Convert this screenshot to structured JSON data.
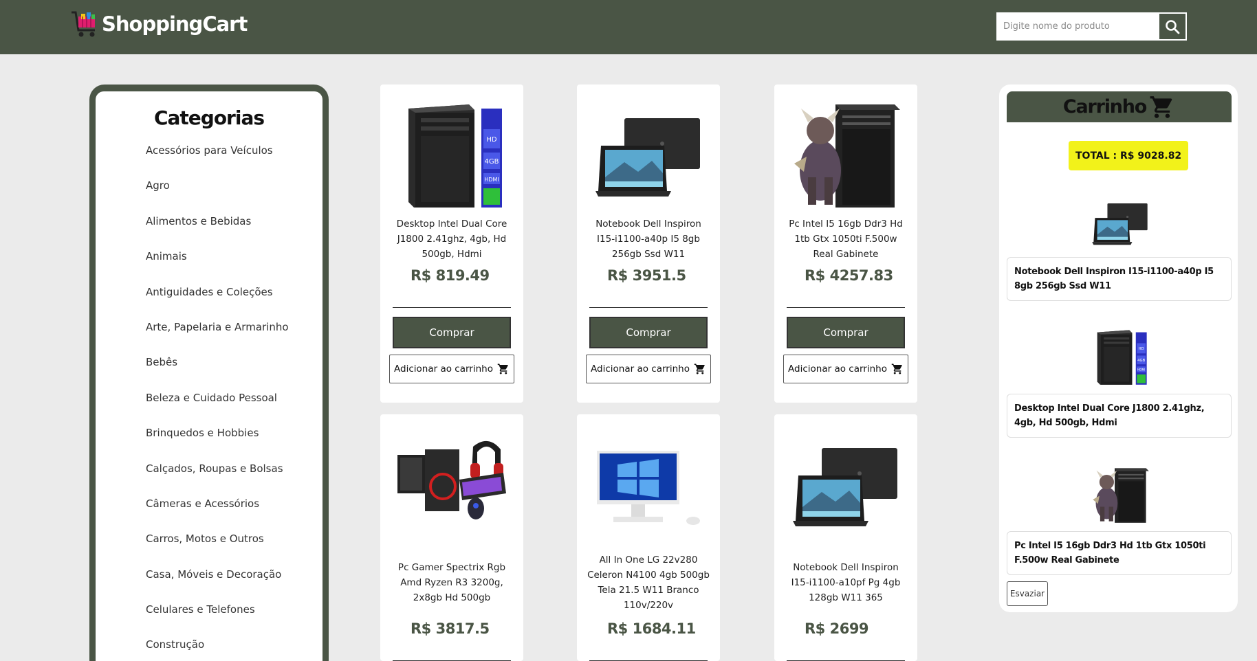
{
  "header": {
    "brand": "ShoppingCart",
    "search_placeholder": "Digite nome do produto"
  },
  "categories": {
    "title": "Categorias",
    "items": [
      "Acessórios para Veículos",
      "Agro",
      "Alimentos e Bebidas",
      "Animais",
      "Antiguidades e Coleções",
      "Arte, Papelaria e Armarinho",
      "Bebês",
      "Beleza e Cuidado Pessoal",
      "Brinquedos e Hobbies",
      "Calçados, Roupas e Bolsas",
      "Câmeras e Acessórios",
      "Carros, Motos e Outros",
      "Casa, Móveis e Decoração",
      "Celulares e Telefones",
      "Construção"
    ]
  },
  "products": [
    {
      "name": "Desktop Intel Dual Core J1800 2.41ghz, 4gb, Hd 500gb, Hdmi",
      "price": "R$ 819.49",
      "image": "desktop-tower-icon",
      "buy_label": "Comprar",
      "add_label": "Adicionar ao carrinho"
    },
    {
      "name": "Notebook Dell Inspiron I15-i1100-a40p I5 8gb 256gb Ssd W11",
      "price": "R$ 3951.5",
      "image": "laptop-icon",
      "buy_label": "Comprar",
      "add_label": "Adicionar ao carrinho"
    },
    {
      "name": "Pc Intel I5 16gb Ddr3 Hd 1tb Gtx 1050ti F.500w Real Gabinete",
      "price": "R$ 4257.83",
      "image": "gaming-tower-icon",
      "buy_label": "Comprar",
      "add_label": "Adicionar ao carrinho"
    },
    {
      "name": "Pc Gamer Spectrix Rgb Amd Ryzen R3 3200g, 2x8gb Hd 500gb",
      "price": "R$ 3817.5",
      "image": "gamer-kit-icon"
    },
    {
      "name": "All In One LG 22v280 Celeron N4100 4gb 500gb Tela 21.5 W11 Branco 110v/220v",
      "price": "R$ 1684.11",
      "image": "all-in-one-icon"
    },
    {
      "name": "Notebook Dell Inspiron I15-i1100-a10pf Pg 4gb 128gb W11 365",
      "price": "R$ 2699",
      "image": "laptop-icon"
    }
  ],
  "cart": {
    "title": "Carrinho",
    "total": "TOTAL : R$ 9028.82",
    "items": [
      {
        "name": "Notebook Dell Inspiron I15-i1100-a40p I5 8gb 256gb Ssd W11",
        "image": "laptop-icon"
      },
      {
        "name": "Desktop Intel Dual Core J1800 2.41ghz, 4gb, Hd 500gb, Hdmi",
        "image": "desktop-tower-icon"
      },
      {
        "name": "Pc Intel I5 16gb Ddr3 Hd 1tb Gtx 1050ti F.500w Real Gabinete",
        "image": "gaming-tower-icon"
      }
    ],
    "empty_label": "Esvaziar"
  },
  "colors": {
    "brand": "#4a5545",
    "background": "#ebebeb",
    "total_highlight": "#f2f21a"
  }
}
